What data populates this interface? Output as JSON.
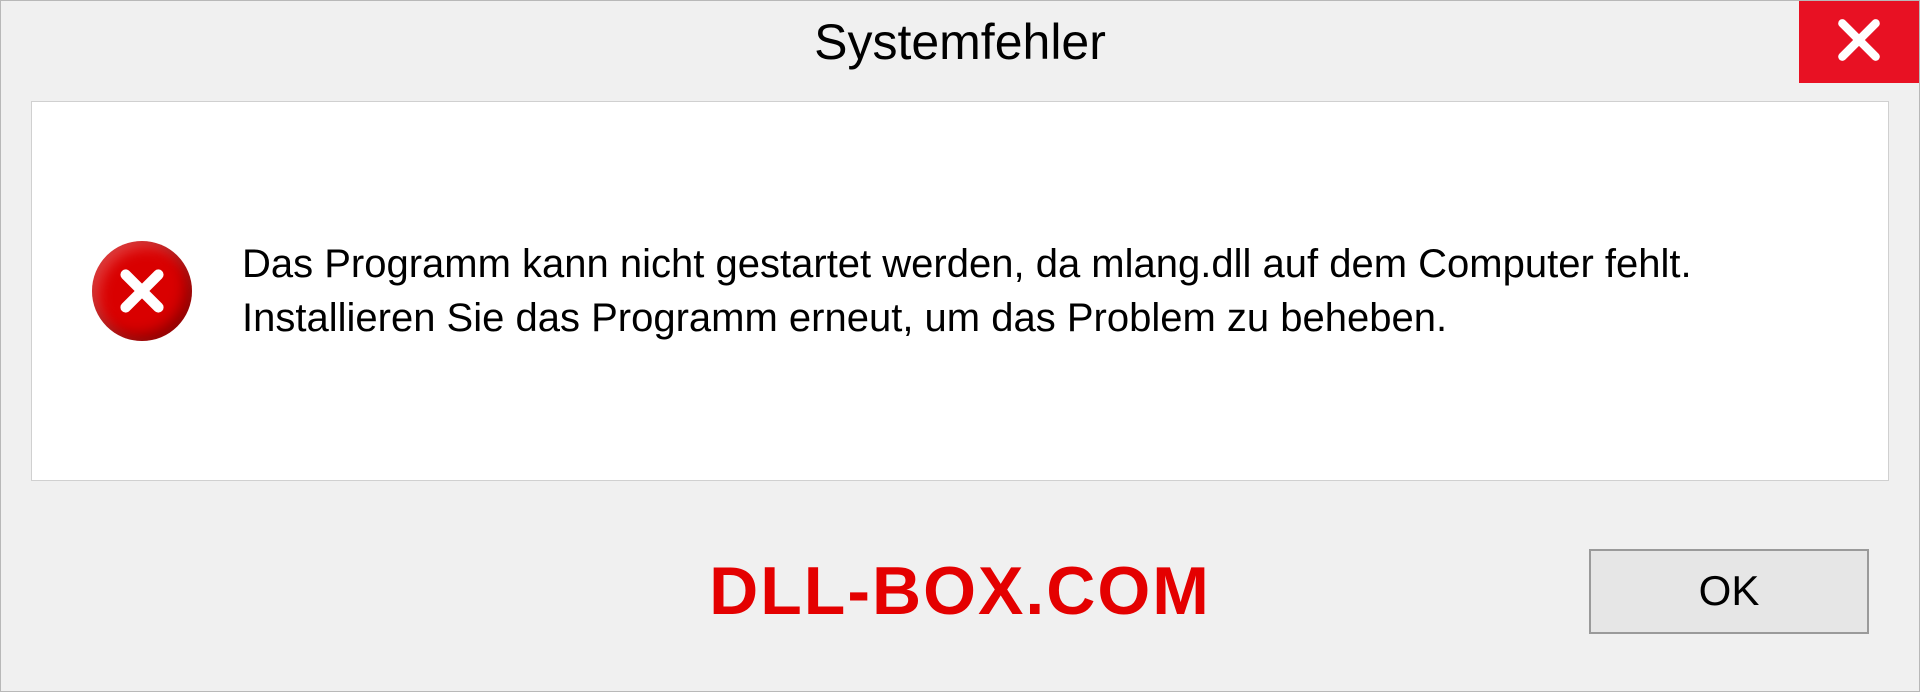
{
  "dialog": {
    "title": "Systemfehler",
    "message": "Das Programm kann nicht gestartet werden, da mlang.dll auf dem Computer fehlt. Installieren Sie das Programm erneut, um das Problem zu beheben.",
    "ok_label": "OK"
  },
  "watermark": "DLL-BOX.COM",
  "colors": {
    "close_bg": "#e81123",
    "error_icon": "#d90000",
    "watermark": "#e40000"
  }
}
